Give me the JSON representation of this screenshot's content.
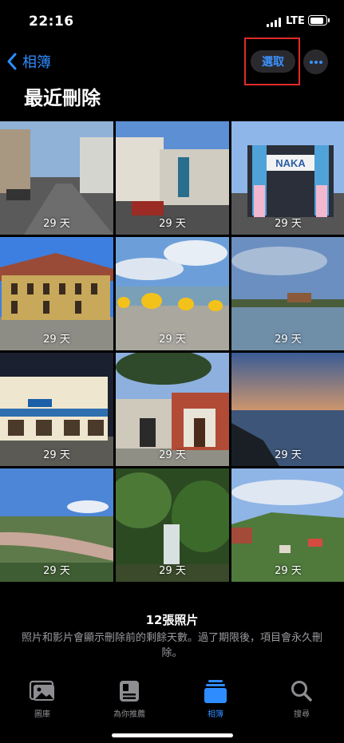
{
  "status": {
    "time": "22:16",
    "network": "LTE",
    "battery_level": 0.9
  },
  "nav": {
    "back_label": "相簿",
    "select_label": "選取"
  },
  "page": {
    "title": "最近刪除"
  },
  "photos": [
    {
      "days": "29 天"
    },
    {
      "days": "29 天"
    },
    {
      "days": "29 天"
    },
    {
      "days": "29 天"
    },
    {
      "days": "29 天"
    },
    {
      "days": "29 天"
    },
    {
      "days": "29 天"
    },
    {
      "days": "29 天"
    },
    {
      "days": "29 天"
    },
    {
      "days": "29 天"
    },
    {
      "days": "29 天"
    },
    {
      "days": "29 天"
    }
  ],
  "photo_signs": {
    "naka": "NAKA"
  },
  "footer": {
    "count": "12張照片",
    "description": "照片和影片會顯示刪除前的剩餘天數。過了期限後，項目會永久刪除。"
  },
  "tabs": [
    {
      "label": "圖庫",
      "icon": "photos-library-icon"
    },
    {
      "label": "為你推薦",
      "icon": "for-you-icon"
    },
    {
      "label": "相簿",
      "icon": "albums-icon"
    },
    {
      "label": "搜尋",
      "icon": "search-icon"
    }
  ],
  "colors": {
    "accent": "#2f8cff",
    "highlight": "#e02a2a",
    "background": "#000000"
  }
}
